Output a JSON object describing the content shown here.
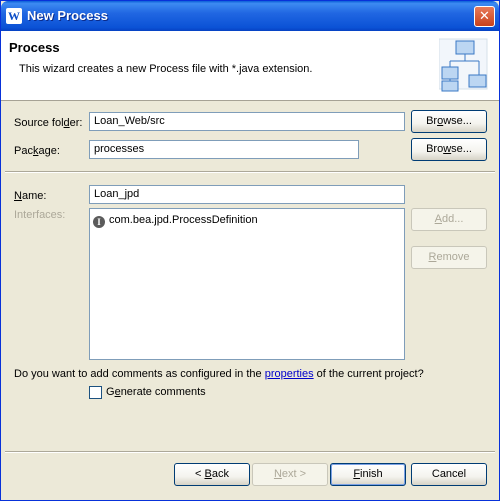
{
  "window": {
    "title": "New Process",
    "app_icon": "W",
    "close_glyph": "✕"
  },
  "header": {
    "title": "Process",
    "description": "This wizard creates a new Process file with *.java extension."
  },
  "form": {
    "source_folder": {
      "label_pre": "Source fol",
      "label_mn": "d",
      "label_post": "er:",
      "value": "Loan_Web/src",
      "browse_pre": "Br",
      "browse_mn": "o",
      "browse_post": "wse..."
    },
    "package": {
      "label_pre": "Pac",
      "label_mn": "k",
      "label_post": "age:",
      "value": "processes",
      "browse_pre": "Bro",
      "browse_mn": "w",
      "browse_post": "se..."
    },
    "name": {
      "label_pre": "",
      "label_mn": "N",
      "label_post": "ame:",
      "value": "Loan_jpd"
    },
    "interfaces": {
      "label": "Interfaces:",
      "items": [
        {
          "icon": "I",
          "label": "com.bea.jpd.ProcessDefinition"
        }
      ]
    },
    "add_pre": "",
    "add_mn": "A",
    "add_post": "dd...",
    "remove_pre": "",
    "remove_mn": "R",
    "remove_post": "emove",
    "comments_question_pre": "Do you want to add comments as configured in the ",
    "comments_link": "properties",
    "comments_question_post": " of the current project?",
    "generate_pre": "G",
    "generate_mn": "e",
    "generate_post": "nerate comments"
  },
  "footer": {
    "back_pre": "< ",
    "back_mn": "B",
    "back_post": "ack",
    "next_pre": "",
    "next_mn": "N",
    "next_post": "ext >",
    "finish_pre": "",
    "finish_mn": "F",
    "finish_post": "inish",
    "cancel": "Cancel"
  },
  "colors": {
    "titlebar": "#0b52d6",
    "accent_border": "#0831d9",
    "link": "#0000cc",
    "disabled_text": "#aca899"
  }
}
